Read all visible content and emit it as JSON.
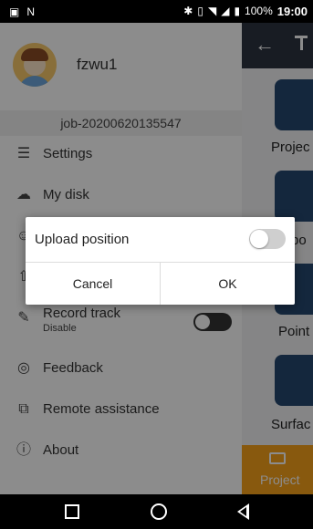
{
  "status_bar": {
    "battery_percent": "100%",
    "time": "19:00",
    "icons": [
      "image-icon",
      "n-icon",
      "bluetooth-icon",
      "vibrate-icon",
      "wifi-icon",
      "signal-icon",
      "battery-icon"
    ]
  },
  "drawer": {
    "username": "fzwu1",
    "job_name": "job-20200620135547",
    "menu": {
      "settings": "Settings",
      "my_disk": "My disk",
      "record_track": "Record track",
      "record_track_status": "Disable",
      "feedback": "Feedback",
      "remote_assistance": "Remote assistance",
      "about": "About"
    }
  },
  "main": {
    "tiles": [
      "Projec",
      "po",
      "Point",
      "Surfac"
    ],
    "bottom_tab": "Project"
  },
  "dialog": {
    "title": "Upload position",
    "switch_on": false,
    "cancel_label": "Cancel",
    "ok_label": "OK"
  },
  "colors": {
    "toolbar": "#2d3440",
    "tile": "#26476f",
    "tab_accent": "#f7a21b"
  }
}
